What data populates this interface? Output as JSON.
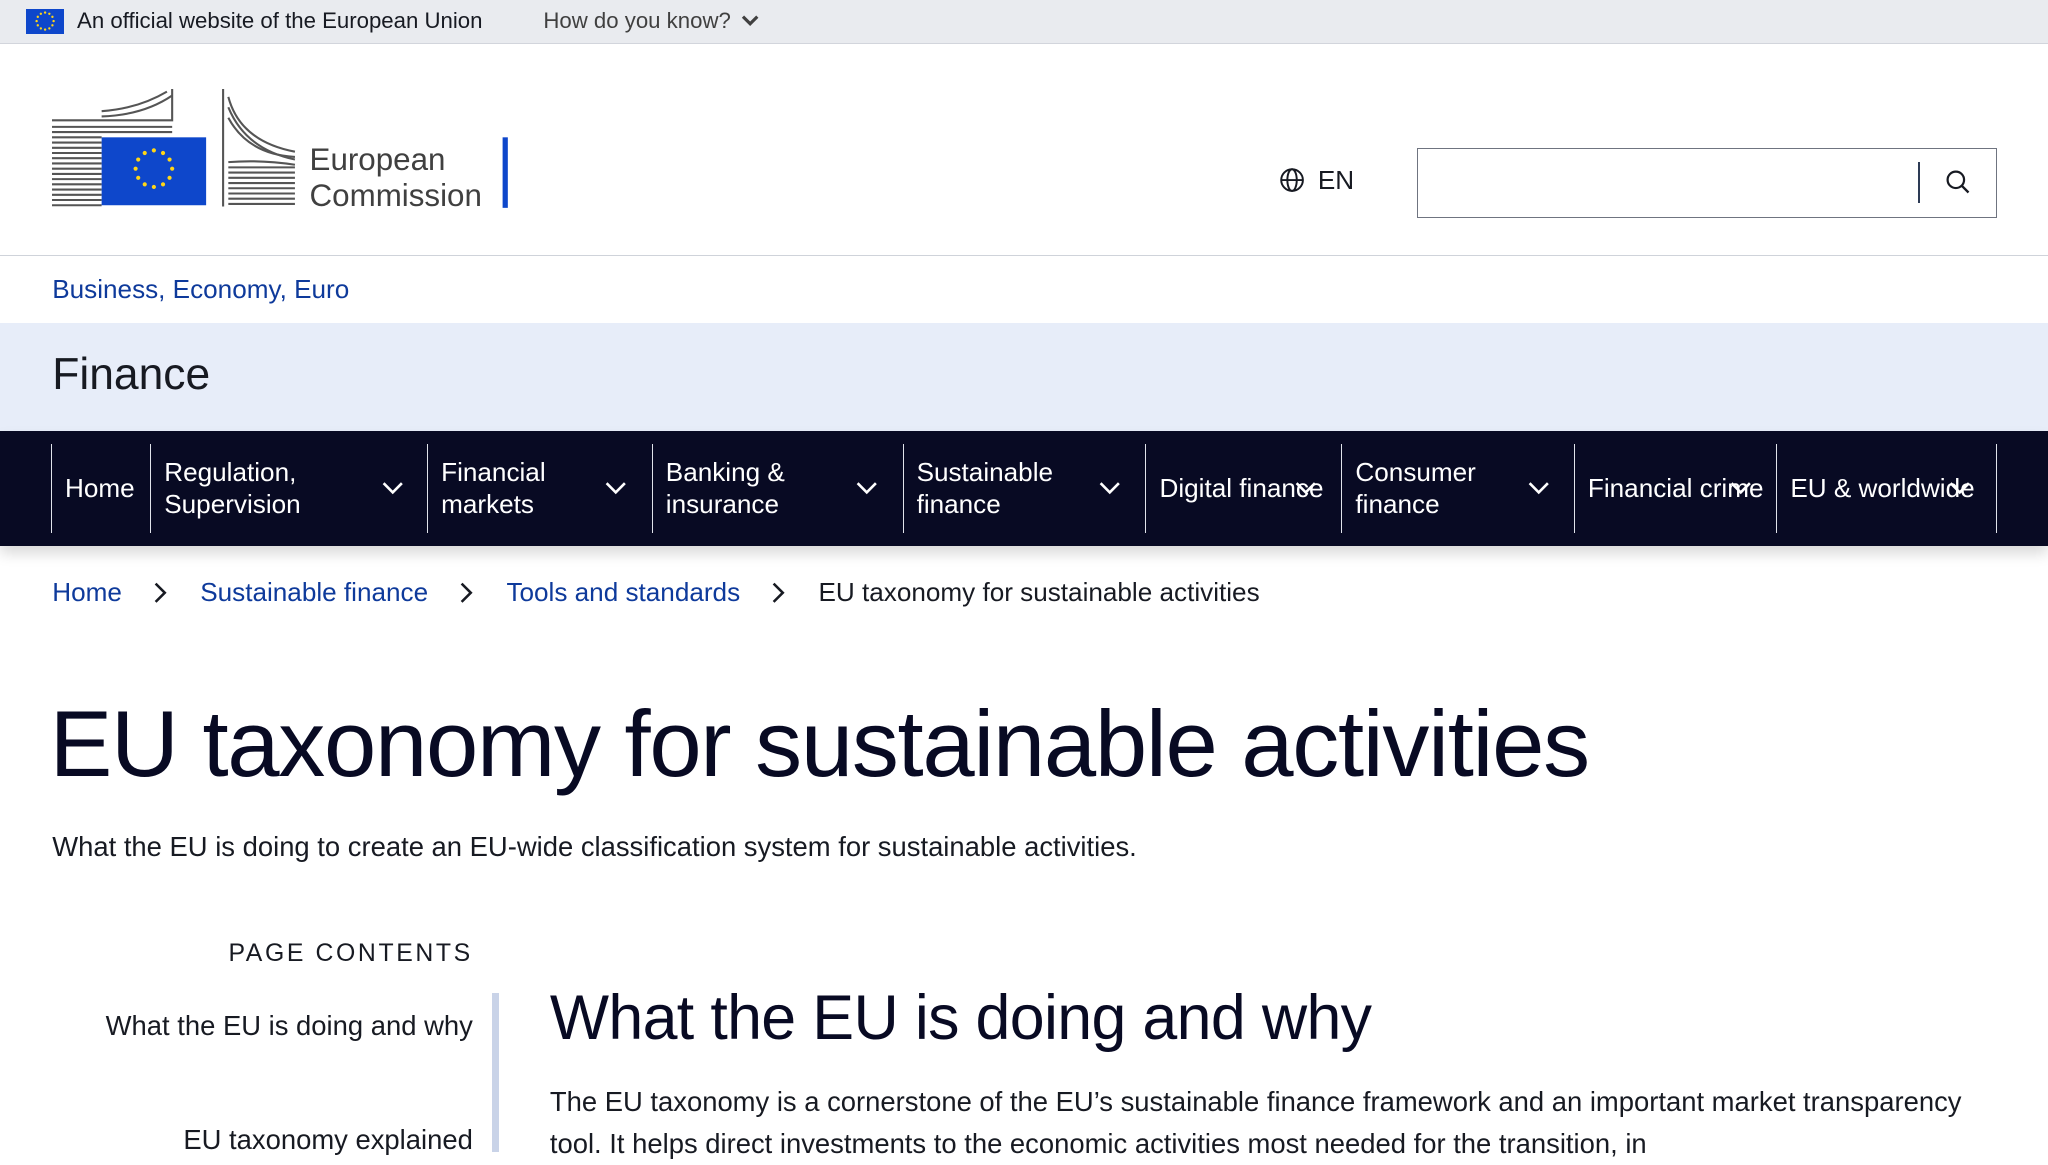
{
  "global_banner": {
    "text": "An official website of the European Union",
    "how_know": "How do you know?"
  },
  "header": {
    "logo_line1": "European",
    "logo_line2": "Commission",
    "language": "EN",
    "search_placeholder": ""
  },
  "site": {
    "parent_link": "Business, Economy, Euro",
    "title": "Finance"
  },
  "nav": {
    "items": [
      {
        "label": "Home"
      },
      {
        "label": "Regulation, Supervision"
      },
      {
        "label": "Financial markets"
      },
      {
        "label": "Banking & insurance"
      },
      {
        "label": "Sustainable finance"
      },
      {
        "label": "Digital finance"
      },
      {
        "label": "Consumer finance"
      },
      {
        "label": "Financial crime"
      },
      {
        "label": "EU & worldwide"
      }
    ]
  },
  "breadcrumb": {
    "items": [
      "Home",
      "Sustainable finance",
      "Tools and standards"
    ],
    "current": "EU taxonomy for sustainable activities"
  },
  "page": {
    "title": "EU taxonomy for sustainable activities",
    "description": "What the EU is doing to create an EU-wide classification system for sustainable activities."
  },
  "page_contents": {
    "heading": "PAGE CONTENTS",
    "items": [
      "What the EU is doing and why",
      "EU taxonomy explained"
    ]
  },
  "section": {
    "title": "What the EU is doing and why",
    "body": "The EU taxonomy is a cornerstone of the EU’s sustainable finance framework and an important market transparency tool. It helps direct investments to the economic activities most needed for the transition, in"
  },
  "colors": {
    "eu_blue": "#0e47cb",
    "nav_bg": "#080a23",
    "link": "#0e3a9b",
    "title_band": "#e7edf9"
  }
}
